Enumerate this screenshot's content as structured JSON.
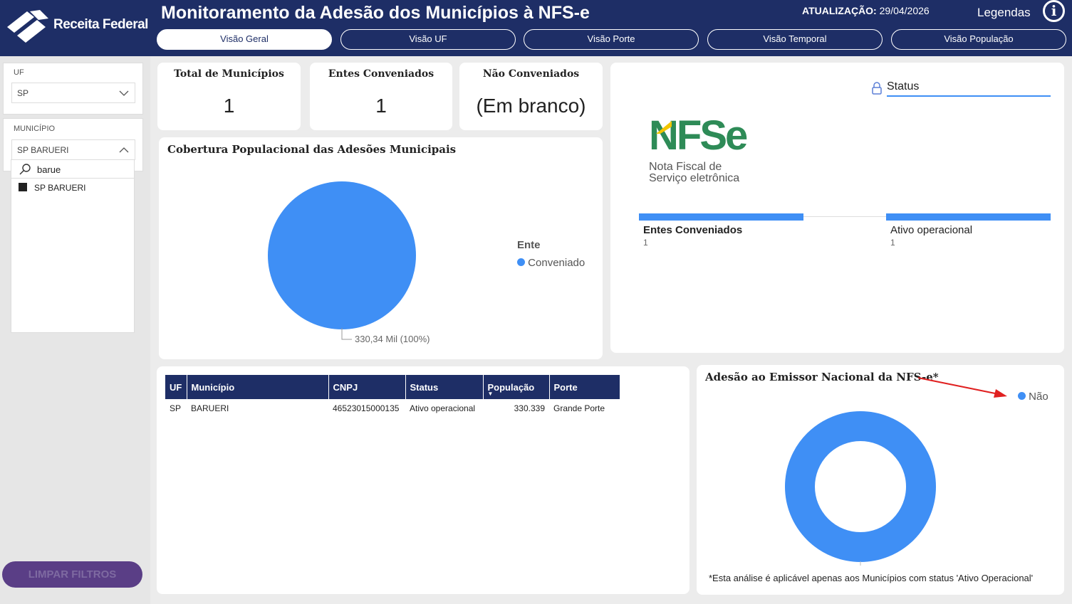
{
  "header": {
    "brand": "Receita Federal",
    "title": "Monitoramento da Adesão dos Municípios à NFS-e",
    "updated_label": "ATUALIZAÇÃO:",
    "updated_value": "29/04/2026",
    "legendas": "Legendas",
    "info_glyph": "i",
    "tabs": [
      {
        "label": "Visão Geral",
        "active": true
      },
      {
        "label": "Visão UF",
        "active": false
      },
      {
        "label": "Visão Porte",
        "active": false
      },
      {
        "label": "Visão Temporal",
        "active": false
      },
      {
        "label": "Visão População",
        "active": false
      }
    ]
  },
  "filters": {
    "uf_label": "UF",
    "uf_value": "SP",
    "municipio_label": "MUNICÍPIO",
    "municipio_value": "SP BARUERI",
    "search_value": "barue",
    "options": [
      "SP BARUERI"
    ],
    "clear_label": "LIMPAR FILTROS"
  },
  "kpis": [
    {
      "title": "Total de Municípios",
      "value": "1"
    },
    {
      "title": "Entes Conveniados",
      "value": "1"
    },
    {
      "title": "Não Conveniados",
      "value": "(Em branco)"
    }
  ],
  "coverage": {
    "title": "Cobertura Populacional das Adesões Municipais",
    "legend_title": "Ente",
    "data_label": "330,34 Mil (100%)",
    "chart_data": {
      "type": "pie",
      "title": "Cobertura Populacional das Adesões Municipais",
      "legend_title": "Ente",
      "categories": [
        "Conveniado"
      ],
      "values": [
        330339
      ],
      "labels": [
        "330,34 Mil (100%)"
      ],
      "colors": [
        "#3f8ff5"
      ],
      "legend_position": "right"
    }
  },
  "status_panel": {
    "status_label": "Status",
    "logo_main": "NFSe",
    "logo_line1": "Nota Fiscal de",
    "logo_line2": "Serviço eletrônica",
    "bars": [
      {
        "label": "Entes Conveniados",
        "count": "1"
      },
      {
        "label": "Ativo operacional",
        "count": "1"
      }
    ]
  },
  "table": {
    "columns": [
      "UF",
      "Município",
      "CNPJ",
      "Status",
      "População",
      "Porte"
    ],
    "sort_indicator": "▼",
    "rows": [
      [
        "SP",
        "BARUERI",
        "46523015000135",
        "Ativo operacional",
        "330.339",
        "Grande Porte"
      ]
    ]
  },
  "adesao": {
    "title": "Adesão ao Emissor Nacional da NFS-e*",
    "legend_label": "Não",
    "footnote": "*Esta análise é aplicável apenas aos Municípios com status 'Ativo Operacional'",
    "chart_data": {
      "type": "pie",
      "subtype": "donut",
      "title": "Adesão ao Emissor Nacional da NFS-e*",
      "categories": [
        "Não"
      ],
      "values": [
        1
      ],
      "colors": [
        "#3f8ff5"
      ],
      "legend_position": "top-right"
    }
  },
  "colors": {
    "header_bg": "#1e2e66",
    "accent_blue": "#3f8ff5",
    "clear_button": "#5a3e86",
    "arrow_red": "#e02020"
  }
}
